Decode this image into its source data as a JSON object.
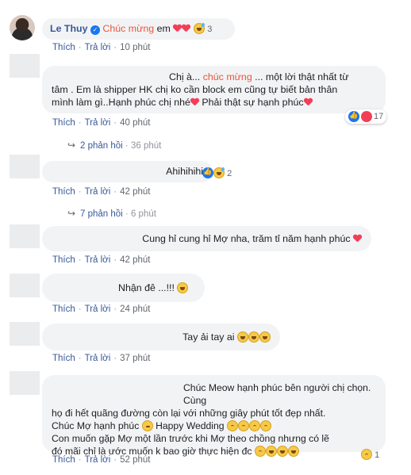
{
  "comments": [
    {
      "name": "Le Thuy",
      "verified": true,
      "text_highlight": "Chúc mừng",
      "text_rest": " em",
      "reaction_count": "3",
      "actions": {
        "like": "Thích",
        "reply": "Trả lời",
        "time": "10 phút"
      }
    },
    {
      "lines": [
        {
          "pre": "Chị à... ",
          "hl": "chúc mừng",
          "post": " ... một lời thật nhất từ"
        },
        {
          "text": "tâm . Em là shipper HK chị ko cần block em cũng tự biết bản thân"
        },
        {
          "text": "mình làm gì..Hạnh phúc chị nhé",
          "text2": " Phải thật sự hạnh phúc"
        }
      ],
      "reaction_count": "17",
      "actions": {
        "like": "Thích",
        "reply": "Trả lời",
        "time": "40 phút"
      },
      "replies": {
        "label": "2 phản hồi",
        "time": "36 phút"
      }
    },
    {
      "text": "Ahihihihi",
      "reaction_count": "2",
      "actions": {
        "like": "Thích",
        "reply": "Trả lời",
        "time": "42 phút"
      },
      "replies": {
        "label": "7 phản hồi",
        "time": "6 phút"
      }
    },
    {
      "text": "Cung hỉ cung hỉ Mợ nha, trăm tỉ năm hạnh phúc",
      "actions": {
        "like": "Thích",
        "reply": "Trả lời",
        "time": "42 phút"
      }
    },
    {
      "text": "Nhận đê ...!!!",
      "actions": {
        "like": "Thích",
        "reply": "Trả lời",
        "time": "24 phút"
      }
    },
    {
      "text": "Tay ải tay ai",
      "actions": {
        "like": "Thích",
        "reply": "Trả lời",
        "time": "37 phút"
      }
    },
    {
      "lines": [
        {
          "text": "Chúc Meow hạnh phúc bên người chị chọn. Cùng"
        },
        {
          "text": "họ đi hết quãng đường còn lại với những giây phút tốt đẹp nhất."
        },
        {
          "text": "Chúc Mợ hạnh phúc",
          "text2": " Happy Wedding"
        },
        {
          "text": "Con muốn gặp Mợ một lần trước khi Mợ theo chồng nhưng có lẽ"
        },
        {
          "text": "đó mãi chỉ là ước muốn k bao giờ thực hiện đc"
        }
      ],
      "reaction_count": "1",
      "actions": {
        "like": "Thích",
        "reply": "Trả lời",
        "time": "52 phút"
      }
    }
  ]
}
